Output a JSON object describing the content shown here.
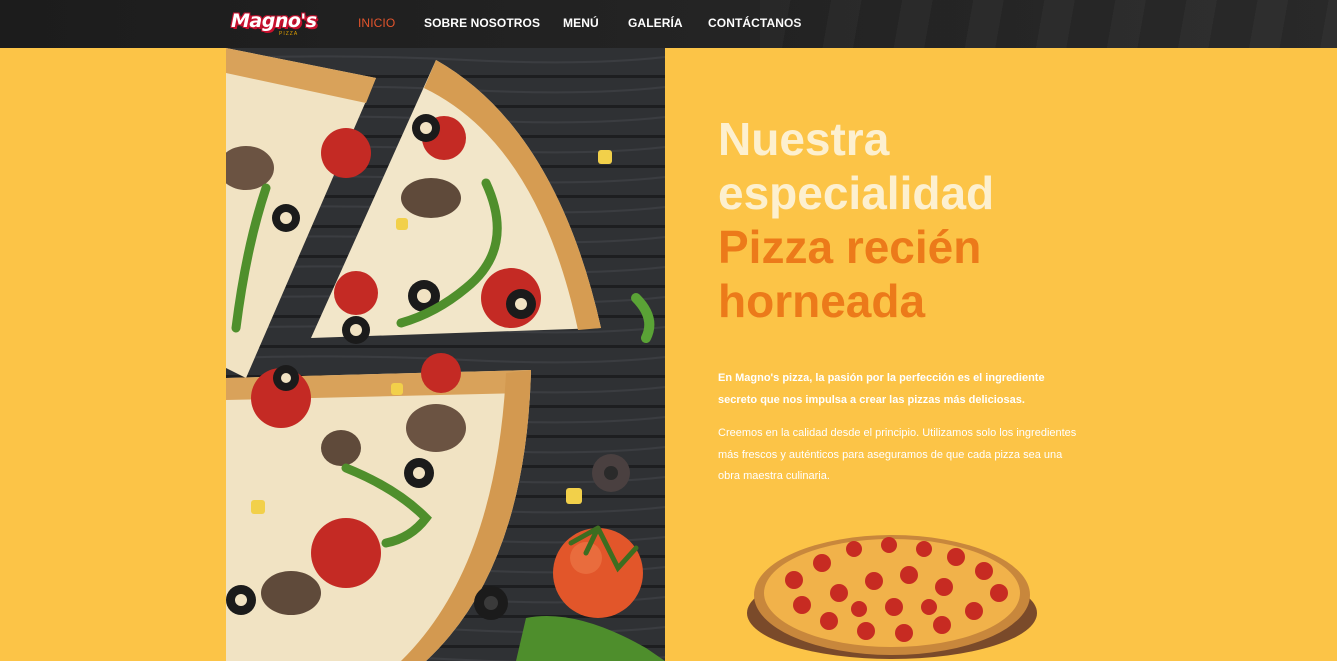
{
  "brand": {
    "name": "Magno's",
    "sub": "PIZZA"
  },
  "nav": {
    "items": [
      {
        "label": "INICIO",
        "active": true
      },
      {
        "label": "SOBRE NOSOTROS",
        "active": false
      },
      {
        "label": "MENÚ",
        "active": false
      },
      {
        "label": "GALERÍA",
        "active": false
      },
      {
        "label": "CONTÁCTANOS",
        "active": false
      }
    ]
  },
  "hero": {
    "title_line1": "Nuestra",
    "title_line2": "especialidad",
    "title_line3": "Pizza recién",
    "title_line4": "horneada",
    "paragraph1": "En Magno's pizza, la pasión por la perfección es el ingrediente secreto que nos impulsa a crear las pizzas más deliciosas.",
    "paragraph2": "Creemos en la calidad desde el principio. Utilizamos solo los ingredientes más frescos y auténticos para aseguramos de que cada pizza sea una obra maestra culinaria."
  },
  "colors": {
    "background": "#fcc447",
    "nav_background": "#1f1f1f",
    "nav_active": "#e3542c",
    "title_light": "#fdf0cf",
    "title_accent": "#ec7a1a"
  }
}
